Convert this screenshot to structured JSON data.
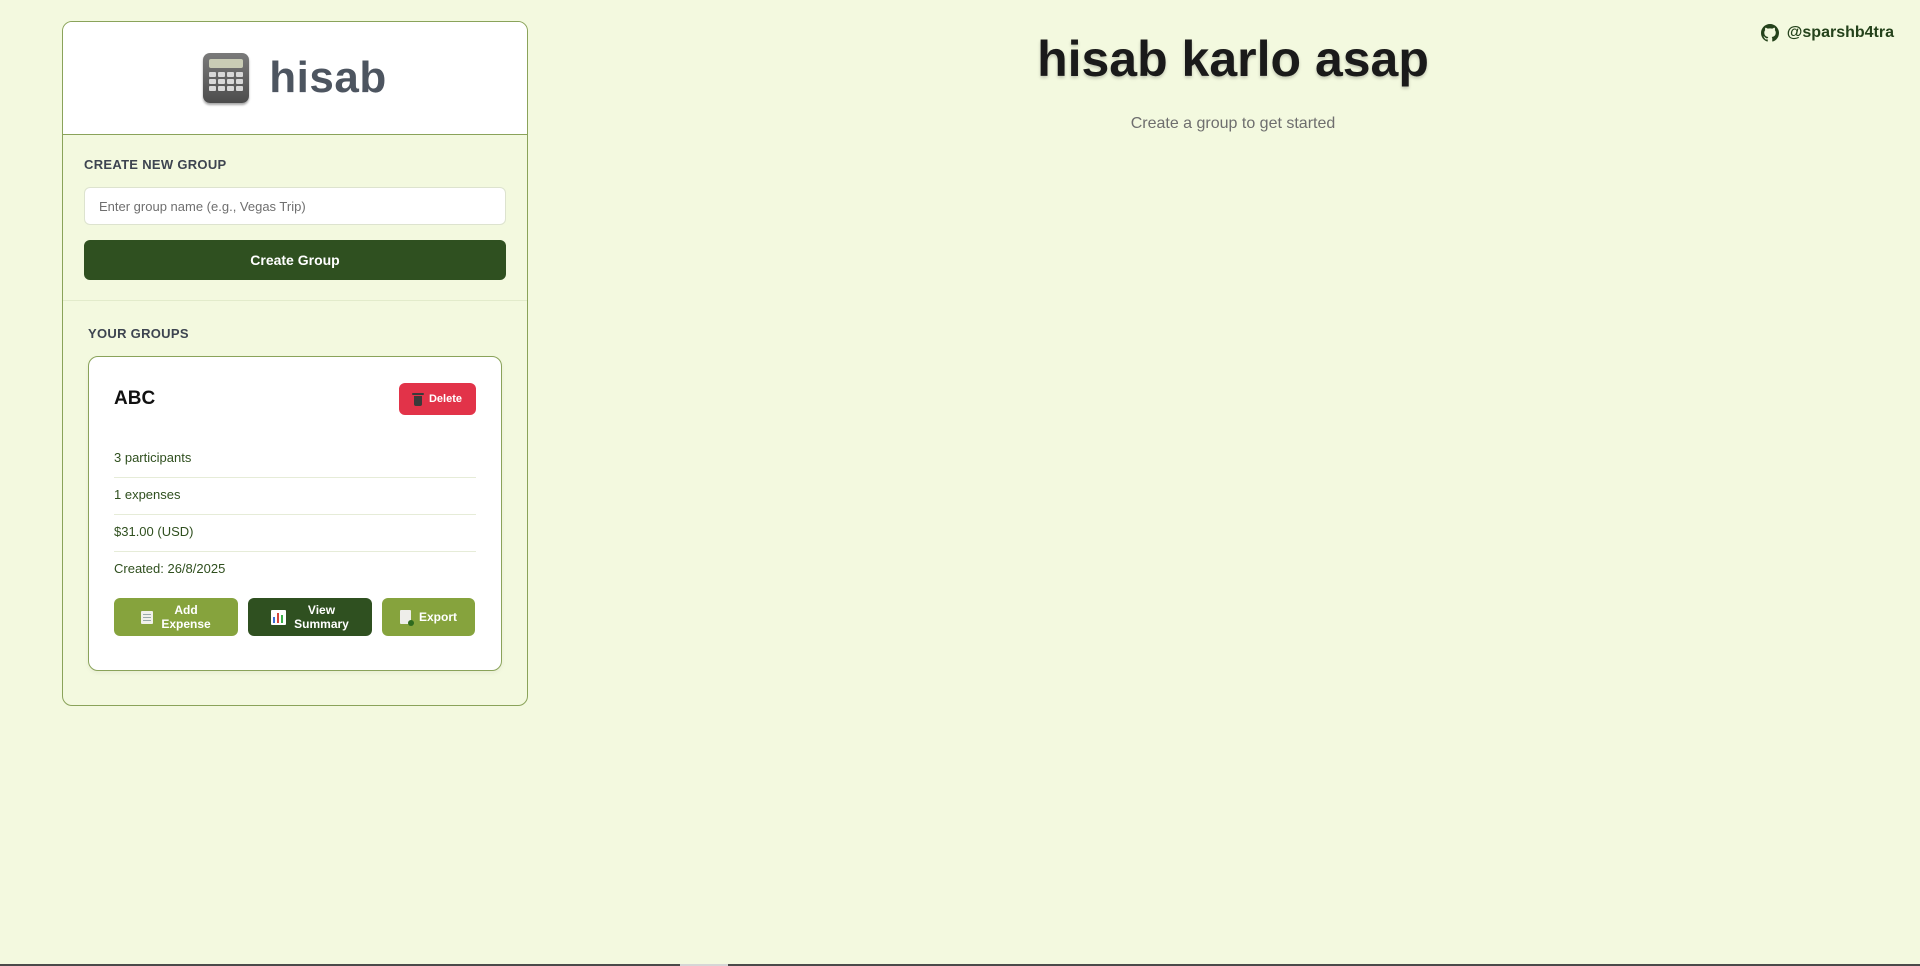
{
  "app": {
    "brand_name": "hisab",
    "brand_icon": "calculator-icon",
    "title": "hisab karlo asap",
    "subtitle": "Create a group to get started"
  },
  "github": {
    "handle": "@sparshb4tra",
    "icon": "github-icon"
  },
  "create_group": {
    "heading": "CREATE NEW GROUP",
    "input_value": "",
    "input_placeholder": "Enter group name (e.g., Vegas Trip)",
    "button_label": "Create Group"
  },
  "your_groups": {
    "heading": "YOUR GROUPS",
    "groups": [
      {
        "name": "ABC",
        "delete_label": "Delete",
        "delete_icon": "trash-icon",
        "participants": "3 participants",
        "expenses": "1 expenses",
        "total": "$31.00 (USD)",
        "created": "Created: 26/8/2025",
        "actions": {
          "add_expense_line1": "Add",
          "add_expense_line2": "Expense",
          "add_expense_icon": "receipt-icon",
          "view_summary_line1": "View",
          "view_summary_line2": "Summary",
          "view_summary_icon": "bar-chart-icon",
          "export": "Export",
          "export_icon": "document-icon"
        }
      }
    ]
  },
  "colors": {
    "background": "#f3f9df",
    "primary_dark": "#2f5020",
    "primary_light": "#86a33d",
    "danger": "#e23349",
    "border": "#8aa35a"
  }
}
